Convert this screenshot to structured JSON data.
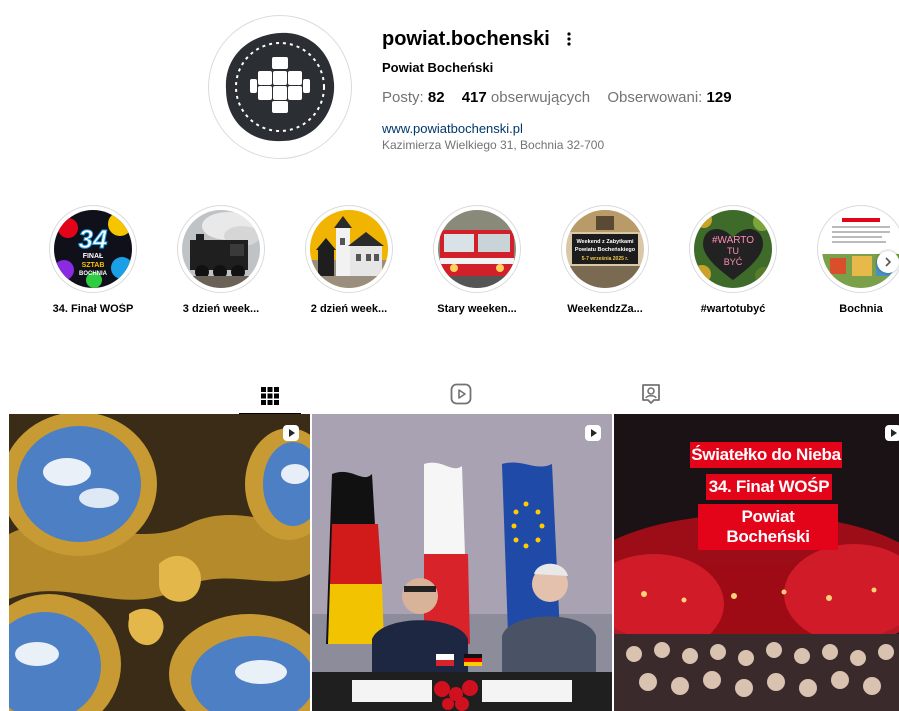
{
  "profile": {
    "username": "powiat.bochenski",
    "full_name": "Powiat Bocheński",
    "stats": {
      "posts_label": "Posty:",
      "posts_value": "82",
      "followers_value": "417",
      "followers_label": "obserwujących",
      "following_label": "Obserwowani:",
      "following_value": "129"
    },
    "website": "www.powiatbochenski.pl",
    "address": "Kazimierza Wielkiego 31, Bochnia 32-700"
  },
  "highlights": [
    {
      "label": "34. Finał WOŚP"
    },
    {
      "label": "3 dzień week..."
    },
    {
      "label": "2 dzień week..."
    },
    {
      "label": "Stary weeken..."
    },
    {
      "label": "WeekendzZa..."
    },
    {
      "label": "#wartotubyć"
    },
    {
      "label": "Bochnia"
    }
  ],
  "highlight_art": {
    "wosp_number": "34",
    "wosp_line1": "FINAŁ",
    "wosp_line2": "SZTAB",
    "wosp_line3": "BOCHNIA",
    "weekend_line1": "Weekend z Zabytkami",
    "weekend_line2": "Powiatu Bocheńskiego",
    "weekend_line3": "5-7 września 2025 r.",
    "warto_line1": "#WARTO",
    "warto_line2": "TU",
    "warto_line3": "BYĆ"
  },
  "tabs": [
    {
      "icon": "grid-icon",
      "active": true
    },
    {
      "icon": "reels-icon",
      "active": false
    },
    {
      "icon": "tagged-icon",
      "active": false
    }
  ],
  "posts": [
    {
      "type": "reel",
      "icon": "reel-icon"
    },
    {
      "type": "reel",
      "icon": "reel-icon"
    },
    {
      "type": "reel",
      "icon": "reel-icon",
      "banner_line1": "Światełko do Nieba",
      "banner_line2": "34. Finał WOŚP",
      "banner_line3": "Powiat Bocheński"
    }
  ],
  "colors": {
    "accent_red": "#e3041a",
    "link": "#00376b",
    "muted": "#737373",
    "logo_dark": "#2b2f33"
  }
}
